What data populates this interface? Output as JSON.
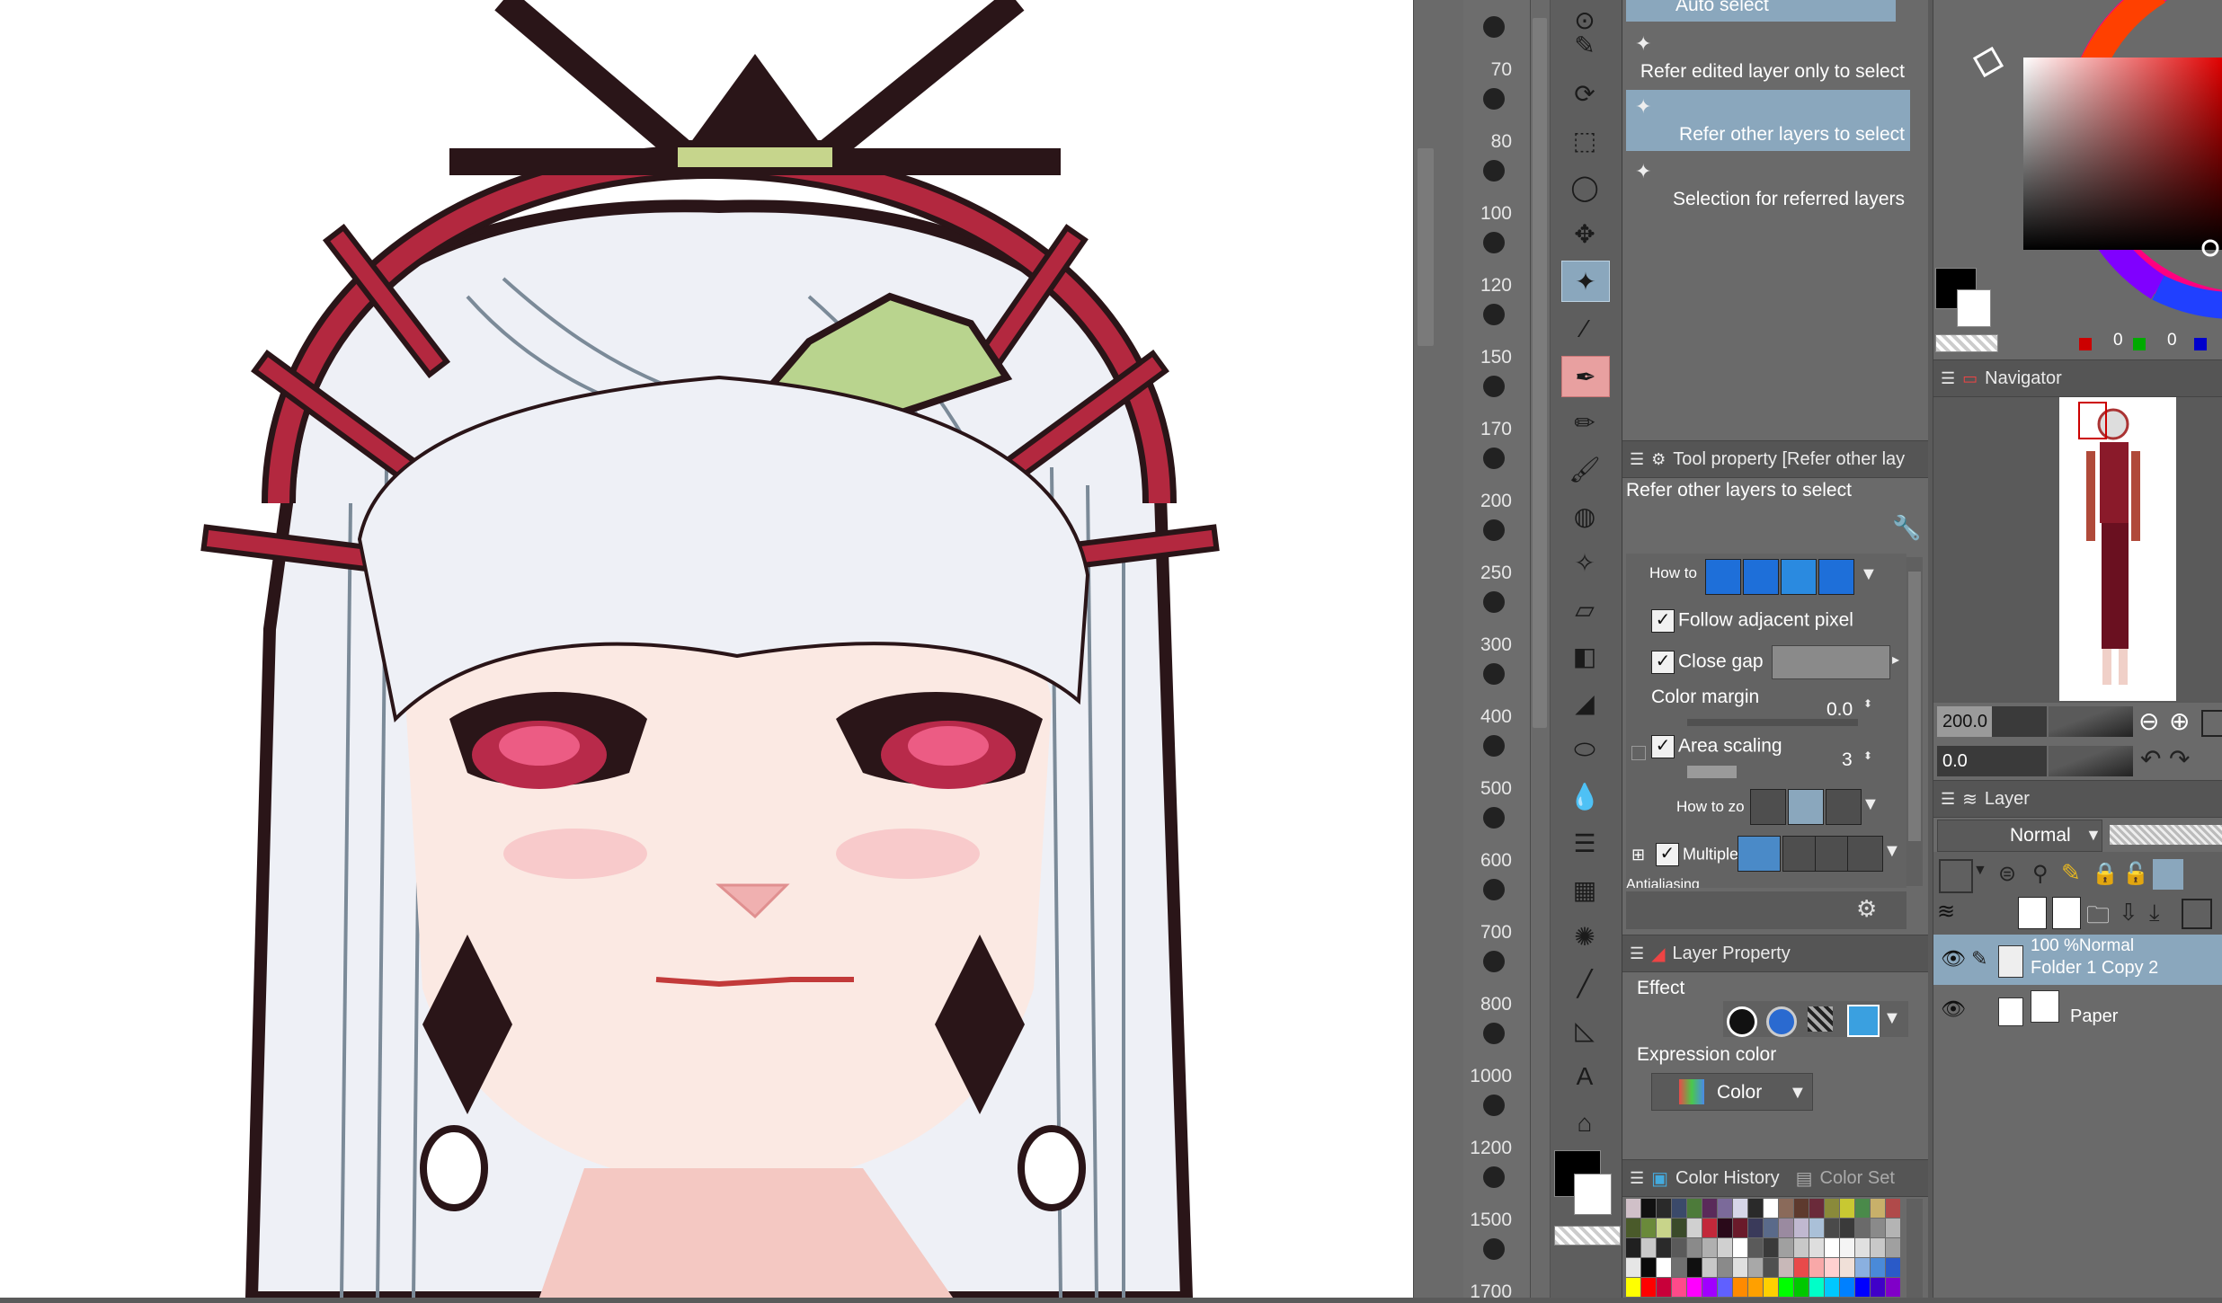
{
  "ruler": {
    "labels": [
      "70",
      "80",
      "100",
      "120",
      "150",
      "170",
      "200",
      "250",
      "300",
      "400",
      "500",
      "600",
      "700",
      "800",
      "1000",
      "1200",
      "1500",
      "1700"
    ]
  },
  "subtools": {
    "top_label": "Auto select",
    "items": [
      {
        "label": "Refer edited layer only to select",
        "selected": false
      },
      {
        "label": "Refer other layers to select",
        "selected": true
      },
      {
        "label": "Selection for referred layers",
        "selected": false
      }
    ]
  },
  "tool_property": {
    "header": "Tool property [Refer other lay",
    "subtitle": "Refer other layers to select",
    "how_to_label": "How to",
    "follow_adjacent": "Follow adjacent pixel",
    "close_gap": "Close gap",
    "color_margin_label": "Color margin",
    "color_margin_value": "0.0",
    "area_scaling_label": "Area scaling",
    "area_scaling_value": "3",
    "how_to_zoom_label": "How to zo",
    "multiple_label": "Multiple",
    "cut_label": "Antialiasing"
  },
  "layer_property": {
    "header": "Layer Property",
    "effect_label": "Effect",
    "expression_color_label": "Expression color",
    "expression_color_value": "Color"
  },
  "color_history": {
    "tab1": "Color History",
    "tab2": "Color Set",
    "colors": [
      [
        "#d0c0c8",
        "#111111",
        "#2a2a2a",
        "#3b4a6a",
        "#4d7b3a",
        "#5a2a5a",
        "#7b6a9a",
        "#d6d6e8",
        "#2a2a2a",
        "#ffffff",
        "#8a6a5a",
        "#5e3a2e",
        "#6a2a3a",
        "#8a8a3a",
        "#c8c832",
        "#4a8a4a",
        "#c8b06a",
        "#b04a4a"
      ],
      [
        "#4a5a2a",
        "#6a8a3a",
        "#c8d48a",
        "#3a4a2a",
        "#d0d0d0",
        "#c2283a",
        "#2a0a1a",
        "#6a1a2a",
        "#3a3a5a",
        "#5a6a8a",
        "#9a8aa0",
        "#c0b8d0",
        "#aac0d8",
        "#4a4a4a",
        "#3a3a3a",
        "#6a6a6a",
        "#8a8a8a",
        "#b4b4b4"
      ],
      [
        "#202020",
        "#c8c8c8",
        "#2a2a2a",
        "#5a5a5a",
        "#8a8a8a",
        "#b0b0b0",
        "#d0d0d0",
        "#ffffff",
        "#5a5a5a",
        "#3a3a3a",
        "#a0a0a0",
        "#c8c8c8",
        "#dedede",
        "#ffffff",
        "#f4f4f4",
        "#e0e0e0",
        "#c8c8c8",
        "#a0a0a0"
      ],
      [
        "#e6e6e6",
        "#0a0a0a",
        "#ffffff",
        "#707070",
        "#101010",
        "#c8c8c8",
        "#8a8a8a",
        "#e0e0e0",
        "#a8a8a8",
        "#505050",
        "#c8b8b8",
        "#e84a4a",
        "#f8a8a8",
        "#ffd0d0",
        "#f0e0d8",
        "#8ab0e0",
        "#4a8ad8",
        "#2a5ac8"
      ],
      [
        "#ffff00",
        "#ff0000",
        "#c8003a",
        "#ff4a8a",
        "#ff00ff",
        "#a000ff",
        "#6060ff",
        "#ff8a00",
        "#ffa000",
        "#ffd000",
        "#00ff00",
        "#00c800",
        "#00ffc8",
        "#00c8ff",
        "#0080ff",
        "#0000ff",
        "#4000c8",
        "#8000c8"
      ]
    ]
  },
  "navigator": {
    "header": "Navigator",
    "zoom": "200.0",
    "rotation": "0.0"
  },
  "color_readout": {
    "r": "0",
    "g": "0",
    "b": "0"
  },
  "layer_panel": {
    "header": "Layer",
    "blend_mode": "Normal",
    "layers": [
      {
        "line1": "100 %Normal",
        "line2": "Folder 1 Copy 2",
        "selected": true
      },
      {
        "line1": "",
        "line2": "Paper",
        "selected": false
      }
    ]
  },
  "colors": {
    "accent_selected": "#8aa7bd",
    "panel_bg": "#6a6a6a",
    "canvas_bg": "#ffffff"
  }
}
